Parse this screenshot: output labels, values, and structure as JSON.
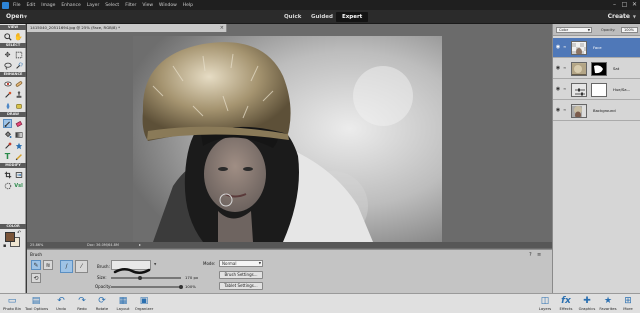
{
  "menubar": {
    "app_icon": "elements-logo-icon",
    "items": [
      "File",
      "Edit",
      "Image",
      "Enhance",
      "Layer",
      "Select",
      "Filter",
      "View",
      "Window",
      "Help"
    ],
    "window_controls": [
      "minimize-icon",
      "restore-icon",
      "close-icon"
    ]
  },
  "modebar": {
    "open_label": "Open",
    "tabs": [
      "Quick",
      "Guided",
      "Expert"
    ],
    "active_tab": "Expert",
    "create_label": "Create"
  },
  "toolbox": {
    "sections": [
      "VIEW",
      "SELECT",
      "ENHANCE",
      "DRAW",
      "MODIFY",
      "COLOR"
    ],
    "colors": {
      "foreground": "#7a5438",
      "background": "#f0e6d2"
    }
  },
  "document": {
    "tab_title": "1415040_20511694.jpg @ 25% (Face, RGB/8) *",
    "zoom": "25.86%",
    "doc_info": "Doc: 36.0M/64.8M"
  },
  "layers_panel": {
    "blend_mode": "Color",
    "opacity_label": "Opacity:",
    "opacity_value": "100%",
    "layers": [
      {
        "name": "Face",
        "selected": true
      },
      {
        "name": "Sat",
        "selected": false
      },
      {
        "name": "Hue/Sa...",
        "selected": false
      },
      {
        "name": "Background",
        "selected": false
      }
    ]
  },
  "tool_options": {
    "title": "Brush",
    "brush_label": "Brush:",
    "size_label": "Size:",
    "size_value": "170 px",
    "opacity_label": "Opacity:",
    "opacity_value": "100%",
    "size_level": 0.42,
    "opacity_level": 1.0,
    "mode_label": "Mode:",
    "mode_value": "Normal",
    "brush_settings_label": "Brush Settings...",
    "tablet_settings_label": "Tablet Settings..."
  },
  "bottom_bar": {
    "left": [
      {
        "label": "Photo Bin",
        "icon": "photo-bin-icon"
      },
      {
        "label": "Tool Options",
        "icon": "tool-options-icon"
      },
      {
        "label": "Undo",
        "icon": "undo-icon"
      },
      {
        "label": "Redo",
        "icon": "redo-icon"
      },
      {
        "label": "Rotate",
        "icon": "rotate-icon"
      },
      {
        "label": "Layout",
        "icon": "layout-icon"
      },
      {
        "label": "Organizer",
        "icon": "organizer-icon"
      }
    ],
    "right": [
      {
        "label": "Layers",
        "icon": "layers-icon"
      },
      {
        "label": "Effects",
        "icon": "effects-icon"
      },
      {
        "label": "Graphics",
        "icon": "graphics-icon"
      },
      {
        "label": "Favorites",
        "icon": "favorites-icon"
      },
      {
        "label": "More",
        "icon": "more-icon"
      }
    ]
  }
}
